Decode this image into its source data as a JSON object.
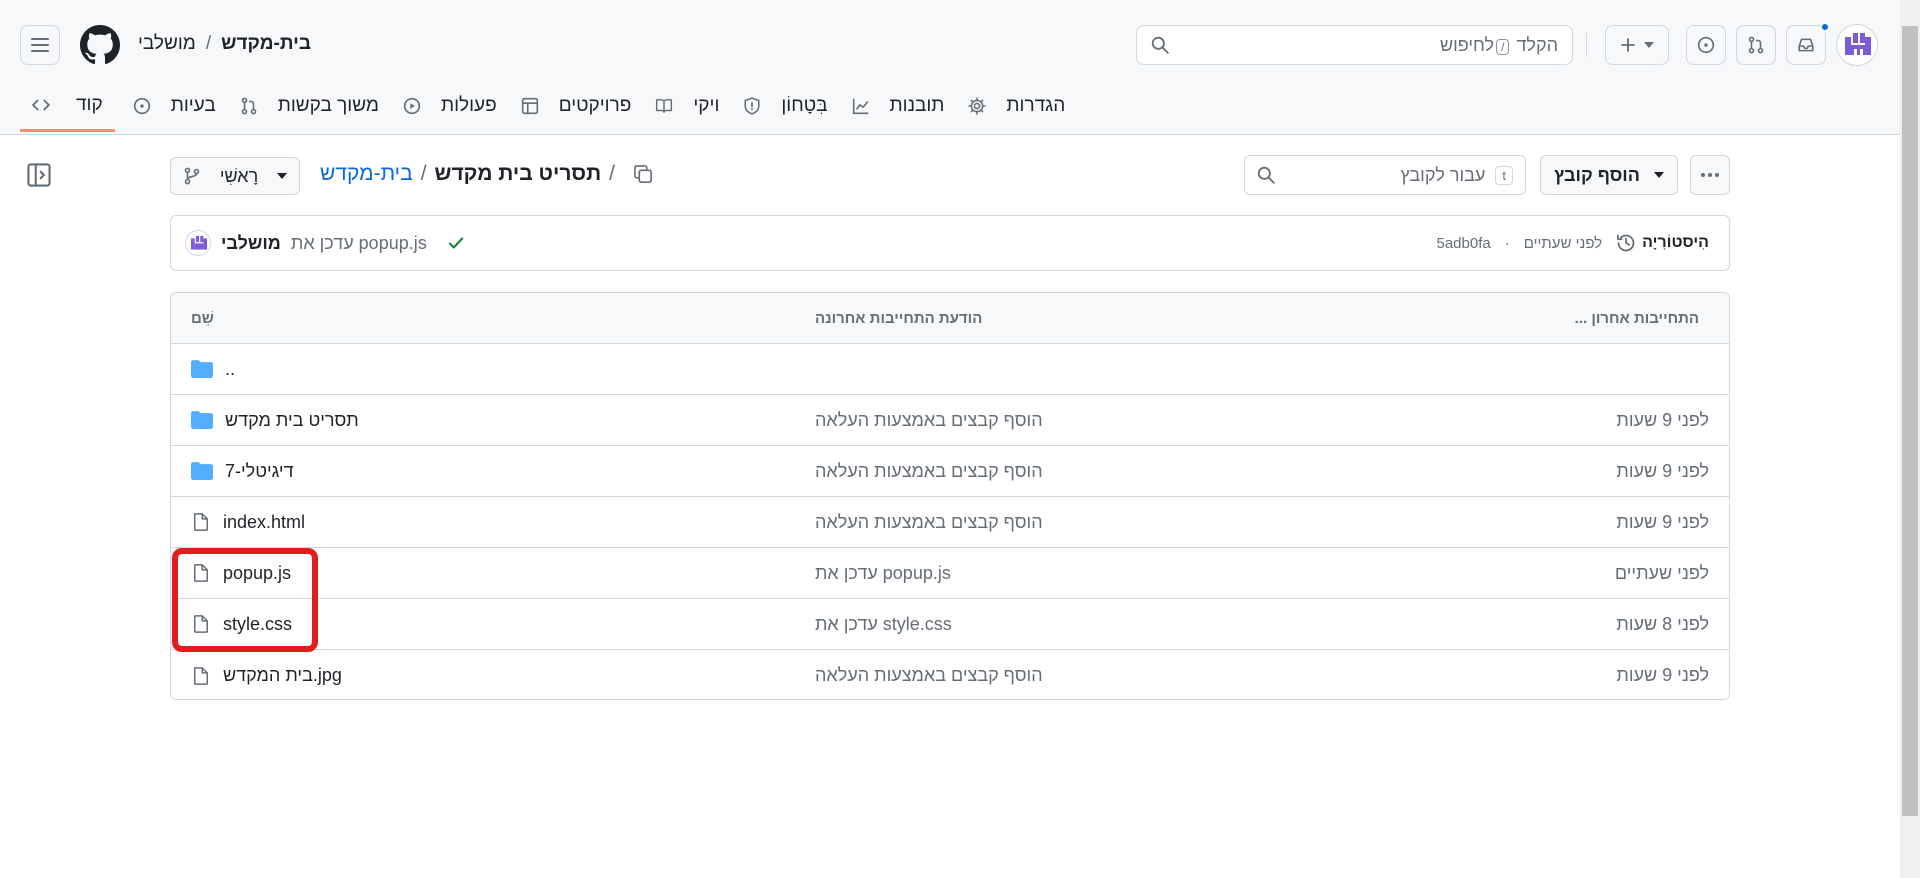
{
  "header": {
    "owner": "מושלבי",
    "separator": "/",
    "repo": "בית-מקדש",
    "search_placeholder_prefix": "הקלד",
    "search_key": "/",
    "search_placeholder_suffix": "לחיפוש"
  },
  "tabs": [
    {
      "label": "קוד",
      "icon": "code-icon",
      "active": true
    },
    {
      "label": "בעיות",
      "icon": "issue-icon"
    },
    {
      "label": "משוך בקשות",
      "icon": "pull-request-icon"
    },
    {
      "label": "פעולות",
      "icon": "play-icon"
    },
    {
      "label": "פרויקטים",
      "icon": "table-icon"
    },
    {
      "label": "ויקי",
      "icon": "book-icon"
    },
    {
      "label": "בִּטָחוֹן",
      "icon": "shield-icon"
    },
    {
      "label": "תובנות",
      "icon": "graph-icon"
    },
    {
      "label": "הגדרות",
      "icon": "gear-icon"
    }
  ],
  "toolbar": {
    "branch": "רָאשִׁי",
    "breadcrumb_repo": "בית-מקדש",
    "breadcrumb_folder": "תסריט בית מקדש",
    "breadcrumb_sep": "/",
    "goto_file_placeholder": "עבור לקובץ",
    "goto_file_key": "t",
    "add_file": "הוסף קובץ"
  },
  "latest_commit": {
    "author": "מושלבי",
    "message": "עדכן את popup.js",
    "sha": "5adb0fa",
    "time": "לפני שעתיים",
    "history": "הִיסטוֹרִיָה"
  },
  "table": {
    "col_name": "שֵׁם",
    "col_message": "הודעת התחייבות אחרונה",
    "col_date": "... התחייבות אחרון",
    "rows": [
      {
        "name": "..",
        "type": "folder",
        "message": "",
        "date": ""
      },
      {
        "name": "תסריט בית מקדש",
        "type": "folder",
        "message": "הוסף קבצים באמצעות העלאה",
        "date": "לפני 9 שעות"
      },
      {
        "name": "דיגיטלי-7",
        "type": "folder",
        "message": "הוסף קבצים באמצעות העלאה",
        "date": "לפני 9 שעות"
      },
      {
        "name": "index.html",
        "type": "file",
        "message": "הוסף קבצים באמצעות העלאה",
        "date": "לפני 9 שעות"
      },
      {
        "name": "popup.js",
        "type": "file",
        "message": "עדכן את popup.js",
        "date": "לפני שעתיים"
      },
      {
        "name": "style.css",
        "type": "file",
        "message": "עדכן את style.css",
        "date": "לפני 8 שעות"
      },
      {
        "name": "בית המקדש.jpg",
        "type": "file",
        "message": "הוסף קבצים באמצעות העלאה",
        "date": "לפני 9 שעות"
      }
    ]
  },
  "colors": {
    "accent": "#0969da",
    "tab_underline": "#fd8c73",
    "folder": "#54aeff",
    "highlight": "#e11d1d",
    "success": "#1a7f37"
  }
}
